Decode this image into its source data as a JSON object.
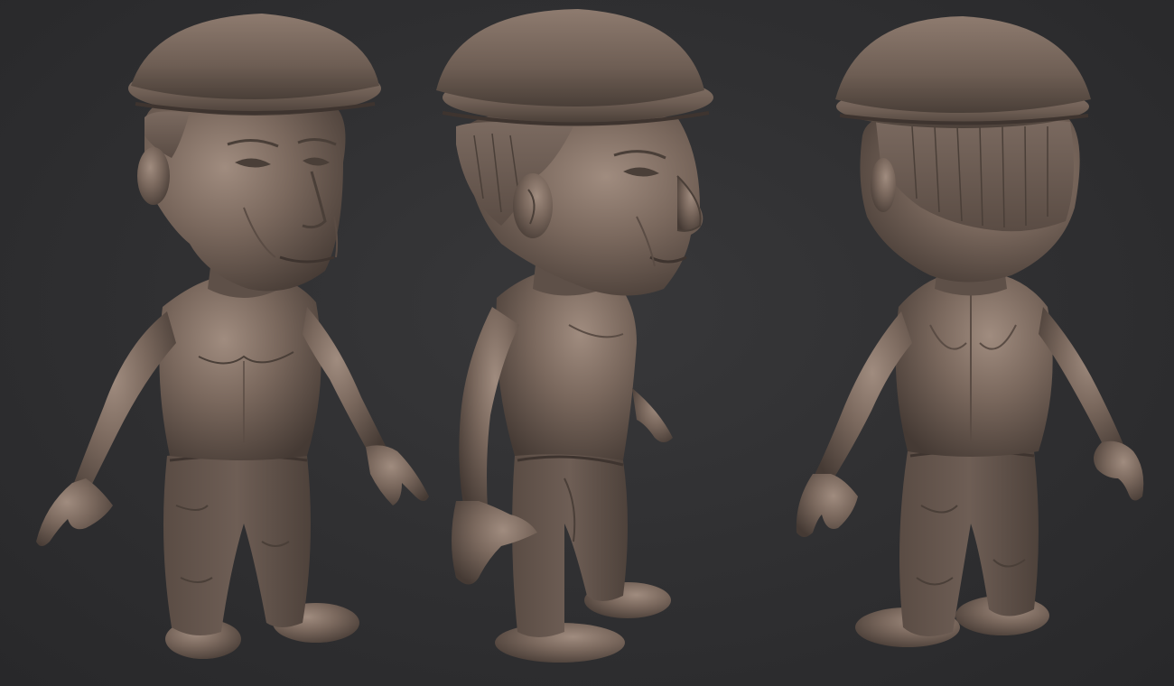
{
  "scene": {
    "background_color": "#303032",
    "clay_color": "#6f5f56",
    "clay_highlight": "#9a877a",
    "clay_shadow": "#3e342f",
    "views": [
      {
        "id": "front-three-quarter",
        "facing": "left-front"
      },
      {
        "id": "side-profile",
        "facing": "right"
      },
      {
        "id": "back-three-quarter",
        "facing": "away"
      }
    ]
  }
}
